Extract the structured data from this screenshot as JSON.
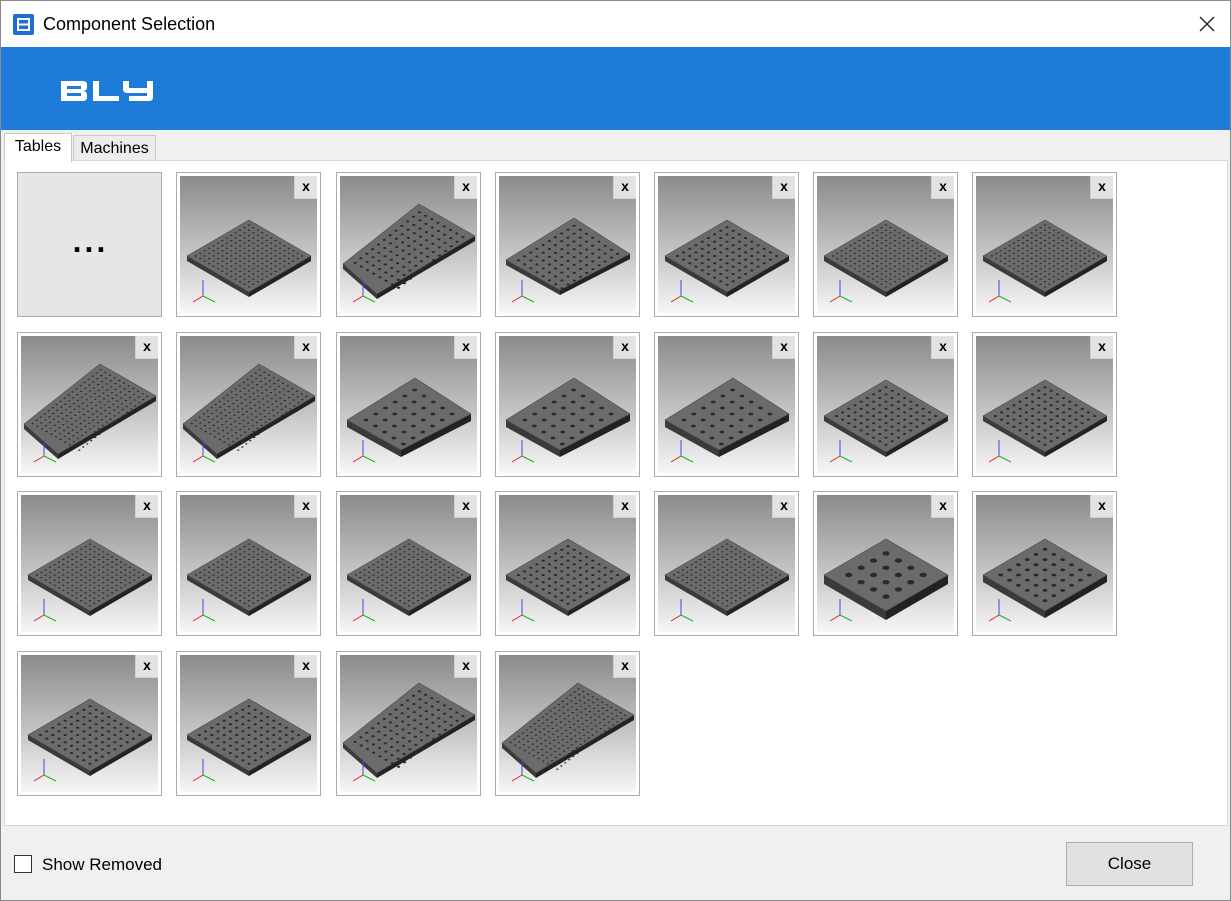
{
  "window": {
    "title": "Component Selection",
    "close_icon": "close-icon",
    "app_icon": "app-icon"
  },
  "banner": {
    "logo_text": "BLY",
    "color": "#1f7bd8"
  },
  "tabs": [
    {
      "label": "Tables",
      "active": true
    },
    {
      "label": "Machines",
      "active": false
    }
  ],
  "grid": {
    "add_tile_label": "...",
    "remove_label": "x",
    "items": [
      {
        "shape": "square",
        "holes": "fine"
      },
      {
        "shape": "long",
        "holes": "medium"
      },
      {
        "shape": "rect",
        "holes": "medium"
      },
      {
        "shape": "square",
        "holes": "medium"
      },
      {
        "shape": "square",
        "holes": "fine"
      },
      {
        "shape": "square",
        "holes": "fine"
      },
      {
        "shape": "long",
        "holes": "fine"
      },
      {
        "shape": "long",
        "holes": "fine"
      },
      {
        "shape": "rect",
        "holes": "large"
      },
      {
        "shape": "rect",
        "holes": "large"
      },
      {
        "shape": "rect",
        "holes": "large"
      },
      {
        "shape": "square",
        "holes": "medium"
      },
      {
        "shape": "square",
        "holes": "medium"
      },
      {
        "shape": "square",
        "holes": "fine"
      },
      {
        "shape": "square",
        "holes": "fine"
      },
      {
        "shape": "square",
        "holes": "fine"
      },
      {
        "shape": "square",
        "holes": "medium"
      },
      {
        "shape": "square",
        "holes": "fine"
      },
      {
        "shape": "square",
        "holes": "xlarge"
      },
      {
        "shape": "square",
        "holes": "large"
      },
      {
        "shape": "square",
        "holes": "medium"
      },
      {
        "shape": "square",
        "holes": "medium"
      },
      {
        "shape": "long",
        "holes": "medium"
      },
      {
        "shape": "long",
        "holes": "fine"
      }
    ]
  },
  "footer": {
    "show_removed_label": "Show Removed",
    "show_removed_checked": false,
    "close_label": "Close"
  }
}
